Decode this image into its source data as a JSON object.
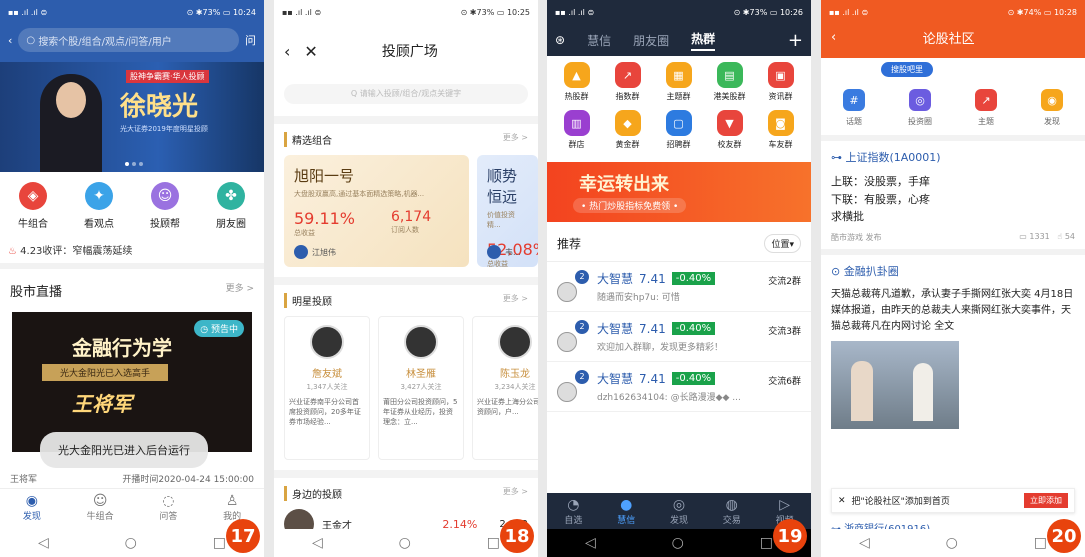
{
  "phone1": {
    "status": {
      "left": "▪▪ .ıl .ıl ⊜",
      "right": "⊙ ✱73% ▭ 10:24"
    },
    "search_placeholder": "搜索个股/组合/观点/问答/用户",
    "ask_label": "问",
    "banner": {
      "tag": "股神争霸赛·华人投顾",
      "name": "徐晓光",
      "sub": "光大证券2019年度明星投顾"
    },
    "grid": [
      "牛组合",
      "看观点",
      "投顾帮",
      "朋友圈"
    ],
    "ticker": "4.23收评：窄幅震荡延续",
    "section": {
      "title": "股市直播",
      "more": "更多 >"
    },
    "live": {
      "badge": "◷ 预告中",
      "title": "金融行为学",
      "band": "光大金阳光已入选高手",
      "name": "王将军"
    },
    "toast": "光大金阳光已进入后台运行",
    "meta_left": "王将军",
    "meta_right": "开播时间2020-04-24 15:00:00",
    "tabs": [
      "发现",
      "牛组合",
      "问答",
      "我的"
    ],
    "number": "17"
  },
  "phone2": {
    "status": {
      "left": "▪▪ .ıl .ıl ⊜",
      "right": "⊙ ✱73% ▭ 10:25"
    },
    "title": "投顾广场",
    "search_placeholder": "Q 请输入投顾/组合/观点关键字",
    "sec1": {
      "title": "精选组合",
      "more": "更多 >"
    },
    "combos": [
      {
        "name": "旭阳一号",
        "desc": "大盘股双赢高,通过基本面精选策略,机器...",
        "ret": "59.11%",
        "ret_label": "总收益",
        "fans": "6,174",
        "fans_label": "订阅人数",
        "owner": "江旭伟"
      },
      {
        "name": "顺势恒远",
        "desc": "价值投资精...",
        "ret": "52.08%",
        "ret_label": "总收益",
        "fans": "",
        "fans_label": "",
        "owner": "韦..."
      }
    ],
    "sec2": {
      "title": "明星投顾",
      "more": "更多 >"
    },
    "advisors": [
      {
        "name": "詹友斌",
        "fans": "1,347人关注",
        "desc": "兴业证券南平分公司首席投资顾问，20多年证券市场经验..."
      },
      {
        "name": "林圣雁",
        "fans": "3,427人关注",
        "desc": "莆田分公司投资顾问，5年证券从业经历，投资理念：立..."
      },
      {
        "name": "陈玉龙",
        "fans": "3,234人关注",
        "desc": "兴业证券上海分公司投资顾问，户..."
      }
    ],
    "sec3": {
      "title": "身边的投顾",
      "more": "更多 >"
    },
    "near": {
      "name": "王金才",
      "pct": "2.14%",
      "num": "2,972"
    },
    "number": "18"
  },
  "phone3": {
    "status": {
      "left": "▪▪ .ıl .ıl ⊜",
      "right": "⊙ ✱73% ▭ 10:26"
    },
    "tabs": [
      "慧信",
      "朋友圈",
      "热群"
    ],
    "icons": [
      "热股群",
      "指数群",
      "主题群",
      "港美股群",
      "资讯群",
      "群店",
      "黄金群",
      "招聘群",
      "校友群",
      "车友群"
    ],
    "lucky_title": "幸运转出来",
    "lucky_sub": "• 热门炒股指标免费领 •",
    "rec_title": "推荐",
    "rec_pos": "位置▾",
    "groups": [
      {
        "name": "大智慧",
        "price": "7.41",
        "chg": "-0.40%",
        "tag": "交流2群",
        "msg": "随遇而安hp7u: 可惜"
      },
      {
        "name": "大智慧",
        "price": "7.41",
        "chg": "-0.40%",
        "tag": "交流3群",
        "msg": "欢迎加入群聊，发现更多精彩！"
      },
      {
        "name": "大智慧",
        "price": "7.41",
        "chg": "-0.40%",
        "tag": "交流6群",
        "msg": "dzh162634104: @长路漫漫◆◆ ..."
      }
    ],
    "bottom_tabs": [
      "自选",
      "慧信",
      "发现",
      "交易",
      "视频"
    ],
    "number": "19"
  },
  "phone4": {
    "status": {
      "left": "▪▪ .ıl .ıl ⊜",
      "right": "⊙ ✱74% ▭ 10:28"
    },
    "title": "论股社区",
    "top_btn": "搜股吧里",
    "grid": [
      "话题",
      "投资圈",
      "主题",
      "发现"
    ],
    "topic1": "⊶ 上证指数(1A0001)",
    "post1": [
      "上联：没股票，手痒",
      "下联：有股票，心疼",
      "求横批"
    ],
    "meta1_left": "酷市游戏 发布",
    "meta1_views": "▭ 1331",
    "meta1_likes": "☝ 54",
    "topic2": "⊙ 金融扒卦圈",
    "post2": "天猫总裁蒋凡道歉，承认妻子手撕网红张大奕 4月18日媒体报道，由昨天的总裁夫人来撕网红张大奕事件，天猫总裁蒋凡在内网讨论 全文",
    "addbar_text": "把\"论股社区\"添加到首页",
    "addbar_btn": "立即添加",
    "next_topic": "⊶ 浙商银行(601916)",
    "number": "20"
  }
}
